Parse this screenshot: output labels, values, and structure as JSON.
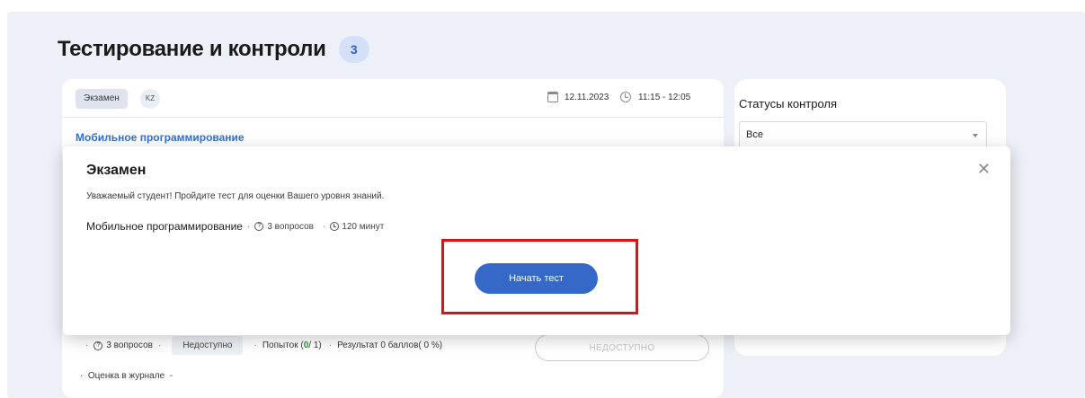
{
  "page": {
    "title": "Тестирование и контроли",
    "count": "3"
  },
  "card": {
    "type_chip": "Экзамен",
    "lang_chip": "KZ",
    "date": "12.11.2023",
    "time": "11:15 - 12:05",
    "course": "Мобильное программирование",
    "questions": "3 вопросов",
    "status": "Недоступно",
    "attempts_label": "Попыток (",
    "attempts_value": "0",
    "attempts_total": " / 1)",
    "result": "Результат 0 баллов( 0 %)",
    "button": "НЕДОСТУПНО",
    "journal_label": "Оценка в журнале",
    "journal_value": "-"
  },
  "sidebar": {
    "title": "Статусы контроля",
    "select_value": "Все"
  },
  "modal": {
    "title": "Экзамен",
    "description": "Уважаемый студент! Пройдите тест для оценки Вашего уровня знаний.",
    "course": "Мобильное программирование",
    "questions": "3 вопросов",
    "duration": "120 минут",
    "start_button": "Начать тест",
    "close_symbol": "✕"
  },
  "colors": {
    "accent": "#3568c7",
    "link": "#2f6fde",
    "highlight": "#e10f14",
    "success": "#2e9a3b"
  }
}
